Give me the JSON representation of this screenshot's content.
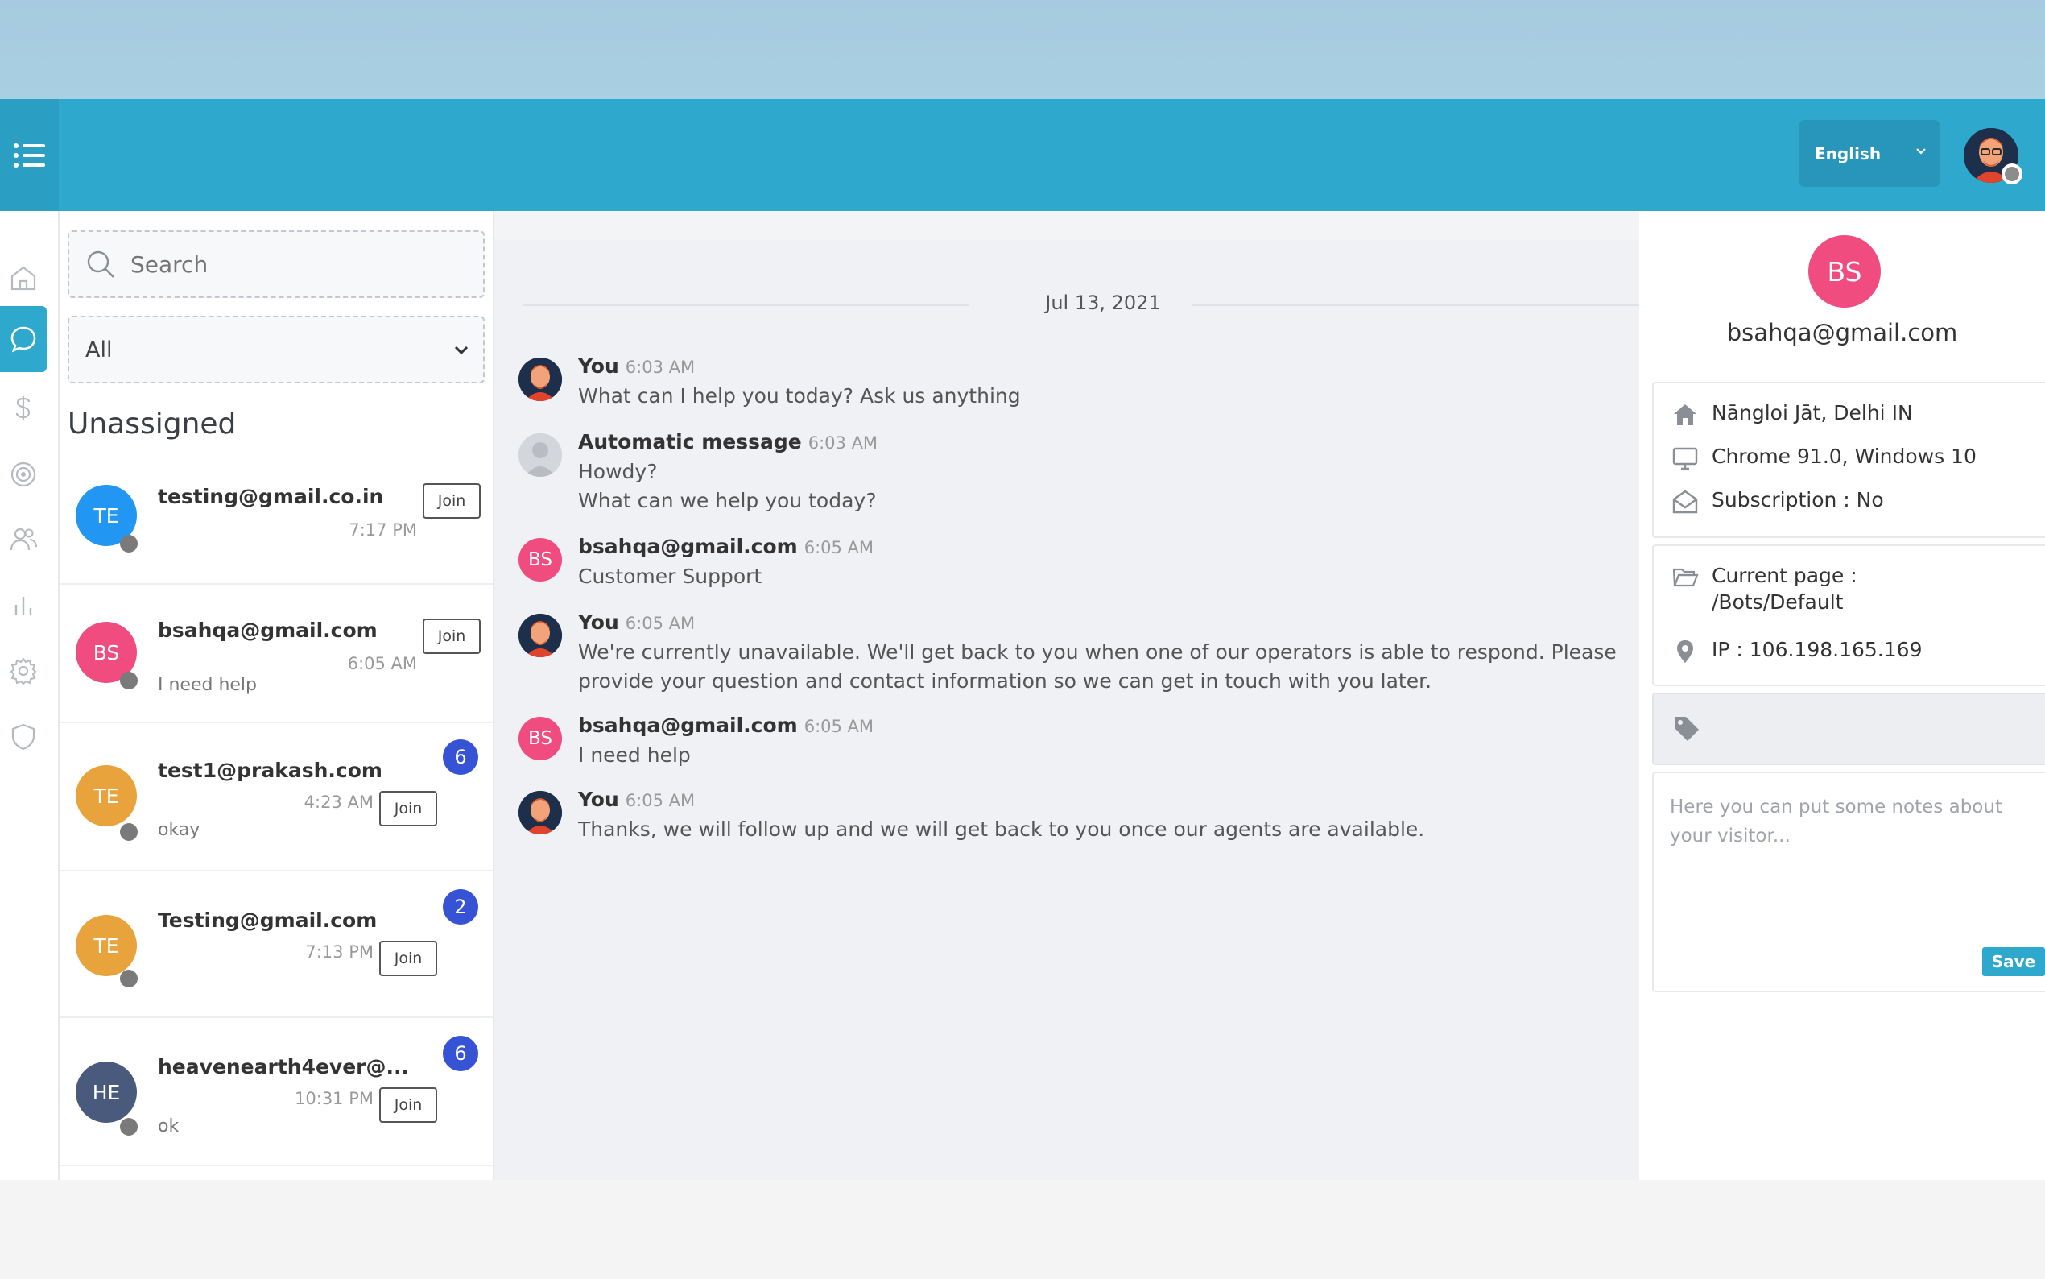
{
  "header": {
    "language": "English",
    "accent_color": "#2fa8ce"
  },
  "sidebar": {
    "items": [
      {
        "name": "home",
        "icon": "home-icon"
      },
      {
        "name": "chat",
        "icon": "chat-bubble-icon",
        "active": true
      },
      {
        "name": "billing",
        "icon": "dollar-icon"
      },
      {
        "name": "target",
        "icon": "target-icon"
      },
      {
        "name": "users",
        "icon": "users-icon"
      },
      {
        "name": "reports",
        "icon": "bar-chart-icon"
      },
      {
        "name": "settings",
        "icon": "gear-icon"
      },
      {
        "name": "security",
        "icon": "shield-icon"
      }
    ]
  },
  "conversations": {
    "search_placeholder": "Search",
    "filter_value": "All",
    "section_title": "Unassigned",
    "items": [
      {
        "initials": "TE",
        "email": "testing@gmail.co.in",
        "time": "7:17 PM",
        "preview": "",
        "badge": "",
        "color": "#2196f3",
        "join": "Join"
      },
      {
        "initials": "BS",
        "email": "bsahqa@gmail.com",
        "time": "6:05 AM",
        "preview": "I need help",
        "badge": "",
        "color": "#f04c7f",
        "join": "Join"
      },
      {
        "initials": "TE",
        "email": "test1@prakash.com",
        "time": "4:23 AM",
        "preview": "okay",
        "badge": "6",
        "color": "#e8a33c",
        "join": "Join"
      },
      {
        "initials": "TE",
        "email": "Testing@gmail.com",
        "time": "7:13 PM",
        "preview": "",
        "badge": "2",
        "color": "#e8a33c",
        "join": "Join"
      },
      {
        "initials": "HE",
        "email": "heavenearth4ever@...",
        "time": "10:31 PM",
        "preview": "ok",
        "badge": "6",
        "color": "#4a5a7c",
        "join": "Join"
      }
    ]
  },
  "chat": {
    "date": "Jul 13, 2021",
    "messages": [
      {
        "sender": "You",
        "time": "6:03 AM",
        "lines": [
          "What can I help you today? Ask us anything"
        ]
      },
      {
        "sender": "Automatic message",
        "time": "6:03 AM",
        "lines": [
          "Howdy?",
          "What can we help you today?"
        ]
      },
      {
        "sender": "bsahqa@gmail.com",
        "time": "6:05 AM",
        "lines": [
          "Customer Support"
        ],
        "initials": "BS"
      },
      {
        "sender": "You",
        "time": "6:05 AM",
        "lines": [
          "We're currently unavailable. We'll get back to you when one of our operators is able to respond. Please",
          "provide your question and contact information so we can get in touch with you later."
        ]
      },
      {
        "sender": "bsahqa@gmail.com",
        "time": "6:05 AM",
        "lines": [
          "I need help"
        ],
        "initials": "BS"
      },
      {
        "sender": "You",
        "time": "6:05 AM",
        "lines": [
          "Thanks, we will follow up and we will get back to you once our agents are available."
        ]
      }
    ]
  },
  "visitor": {
    "initials": "BS",
    "email": "bsahqa@gmail.com",
    "location": "Nāngloi Jāt, Delhi IN",
    "browser": "Chrome 91.0, Windows 10",
    "subscription": "Subscription :  No",
    "current_page_label": "Current page :",
    "current_page": "/Bots/Default",
    "ip": "IP : 106.198.165.169",
    "notes_placeholder": "Here you can put some notes about your visitor...",
    "save_label": "Save"
  }
}
